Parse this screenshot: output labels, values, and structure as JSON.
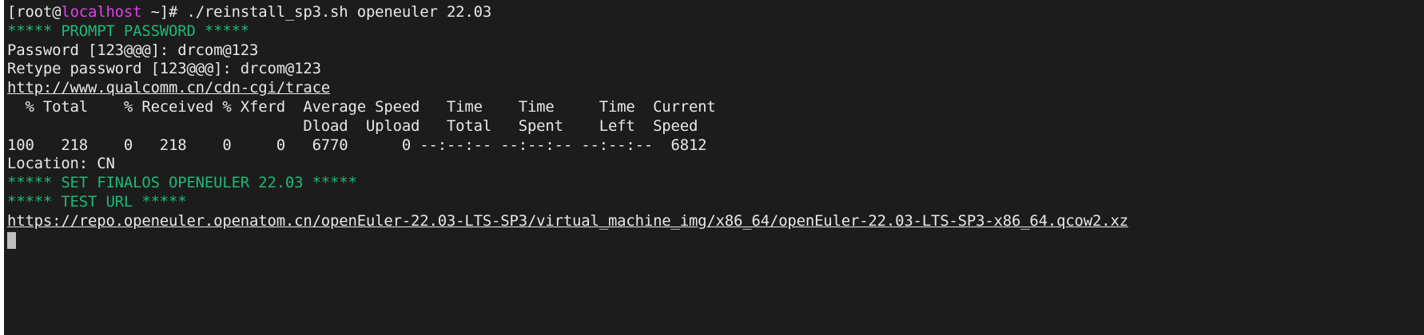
{
  "prompt": {
    "open": "[root@",
    "host": "localhost",
    "close": " ~]# ",
    "command": "./reinstall_sp3.sh openeuler 22.03"
  },
  "lines": {
    "prompt_password": "***** PROMPT PASSWORD *****",
    "password": "Password [123@@@]: drcom@123",
    "retype": "Retype password [123@@@]: drcom@123",
    "trace_url": "http://www.qualcomm.cn/cdn-cgi/trace",
    "curl_header1": "  % Total    % Received % Xferd  Average Speed   Time    Time     Time  Current",
    "curl_header2": "                                 Dload  Upload   Total   Spent    Left  Speed",
    "curl_progress": "100   218    0   218    0     0   6770      0 --:--:-- --:--:-- --:--:--  6812",
    "location": "Location: CN",
    "set_finalos": "***** SET FINALOS OPENEULER 22.03 *****",
    "test_url": "***** TEST URL *****",
    "image_url": "https://repo.openeuler.openatom.cn/openEuler-22.03-LTS-SP3/virtual_machine_img/x86_64/openEuler-22.03-LTS-SP3-x86_64.qcow2.xz"
  },
  "colors": {
    "background": "#1c1c1c",
    "text": "#e8e8e8",
    "banner": "#1fb877",
    "host": "#e040e8"
  }
}
